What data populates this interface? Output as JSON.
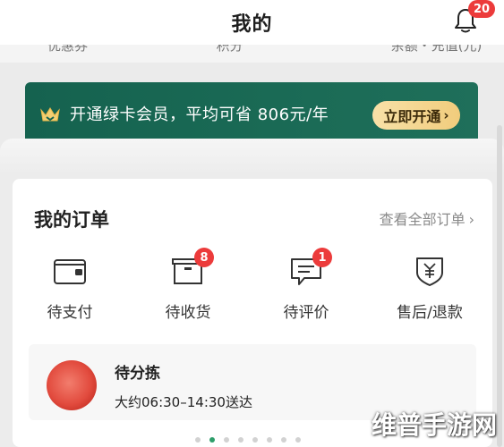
{
  "header": {
    "title": "我的",
    "notification_count": "20"
  },
  "stats": [
    "优惠券",
    "积分",
    "余额・充值(元)"
  ],
  "vip_banner": {
    "text": "开通绿卡会员，平均可省 806元/年",
    "button_label": "立即开通"
  },
  "orders": {
    "title": "我的订单",
    "view_all": "查看全部订单",
    "statuses": [
      {
        "label": "待支付",
        "icon": "wallet-icon",
        "badge": ""
      },
      {
        "label": "待收货",
        "icon": "package-icon",
        "badge": "8"
      },
      {
        "label": "待评价",
        "icon": "comment-icon",
        "badge": "1"
      },
      {
        "label": "售后/退款",
        "icon": "refund-icon",
        "badge": ""
      }
    ],
    "pending": {
      "status": "待分拣",
      "time": "大约06:30–14:30送达"
    }
  },
  "pagination": {
    "pages": 8,
    "active": 1
  },
  "watermark": "维普手游网",
  "colors": {
    "vip_green": "#15624f",
    "vip_button": "#f1cc7c",
    "badge_red": "#ec3b3b",
    "active_dot": "#2e9e6a"
  }
}
